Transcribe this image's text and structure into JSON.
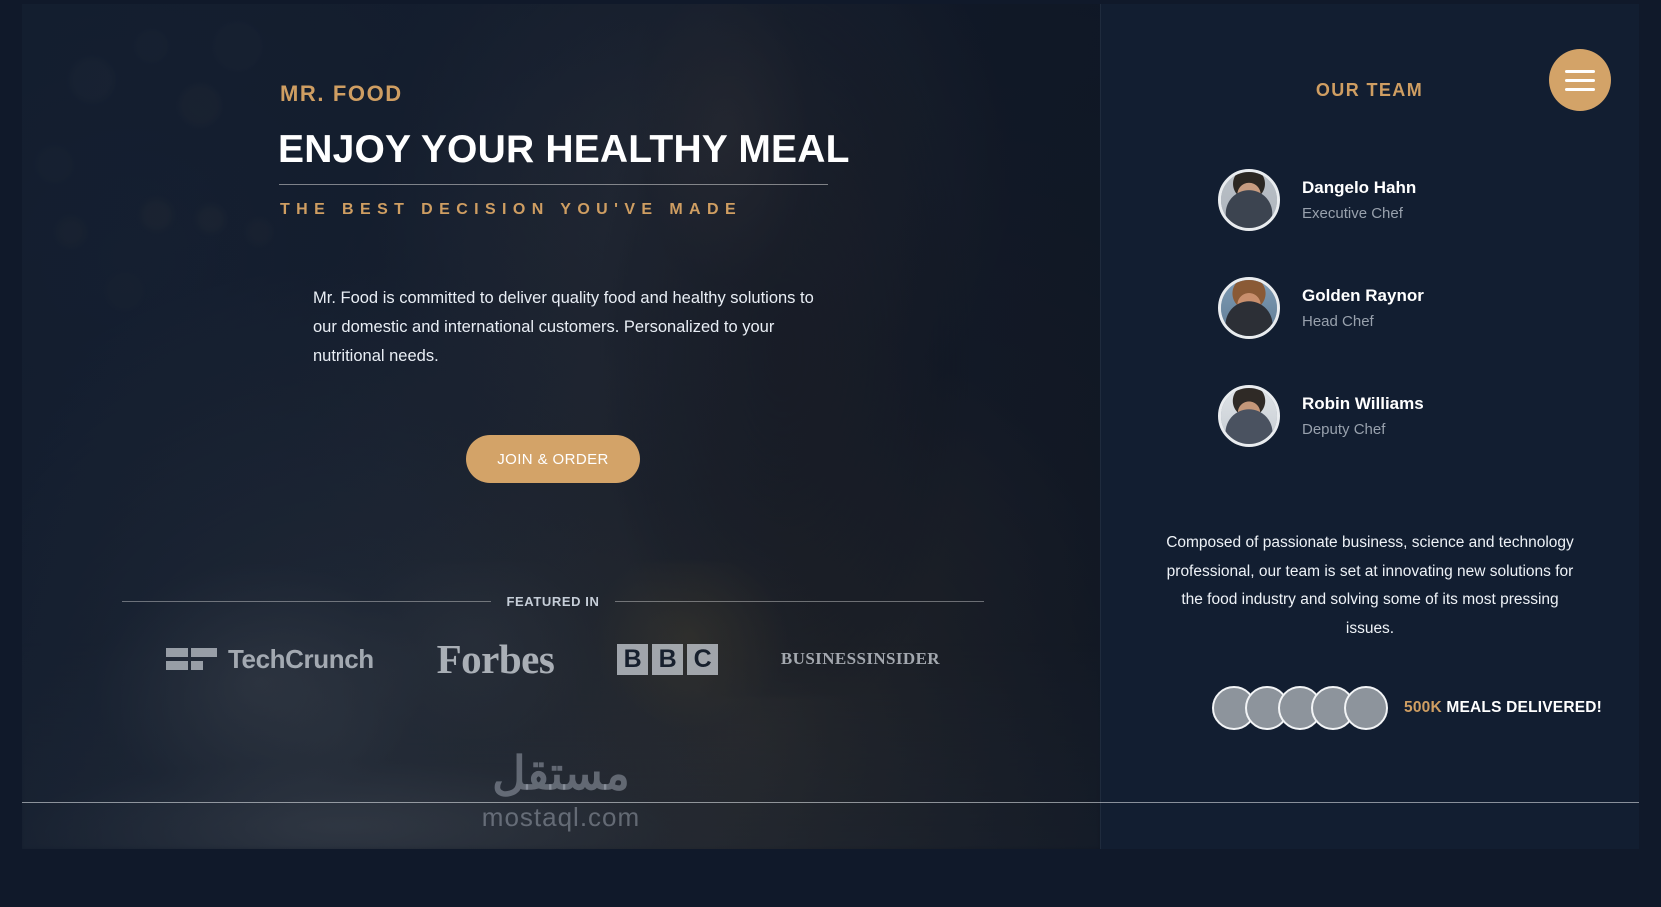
{
  "hero": {
    "eyebrow": "MR. FOOD",
    "headline": "ENJOY YOUR HEALTHY MEAL",
    "subheadline": "THE BEST DECISION YOU'VE MADE",
    "paragraph": "Mr. Food is committed to deliver quality food and healthy solutions to our domestic and international customers. Personalized to your nutritional needs.",
    "cta_label": "JOIN & ORDER",
    "featured_label": "FEATURED IN",
    "logos": [
      {
        "name": "techcrunch-logo",
        "text": "TechCrunch"
      },
      {
        "name": "forbes-logo",
        "text": "Forbes"
      },
      {
        "name": "bbc-logo",
        "letters": [
          "B",
          "B",
          "C"
        ]
      },
      {
        "name": "business-insider-logo",
        "line1": "BUSINESS",
        "line2": "INSIDER"
      }
    ]
  },
  "panel": {
    "title": "OUR TEAM",
    "menu_icon": "hamburger-menu-icon",
    "team": [
      {
        "name": "Dangelo Hahn",
        "role": "Executive Chef"
      },
      {
        "name": "Golden Raynor",
        "role": "Head Chef"
      },
      {
        "name": "Robin Williams",
        "role": "Deputy Chef"
      }
    ],
    "description": "Composed of passionate business, science and technology professional, our team is set at innovating new solutions for the food industry and solving some of its most pressing issues.",
    "stat": {
      "count": "500K",
      "label": "MEALS DELIVERED!"
    }
  },
  "watermark": {
    "arabic": "مستقل",
    "latin": "mostaql.com"
  },
  "colors": {
    "accent_gold": "#cf9e62",
    "button_gold": "#d3a368",
    "panel_bg": "#121e31",
    "hero_bg": "#0d1624",
    "text_light": "#ffffff",
    "text_muted": "#98a1ad"
  }
}
